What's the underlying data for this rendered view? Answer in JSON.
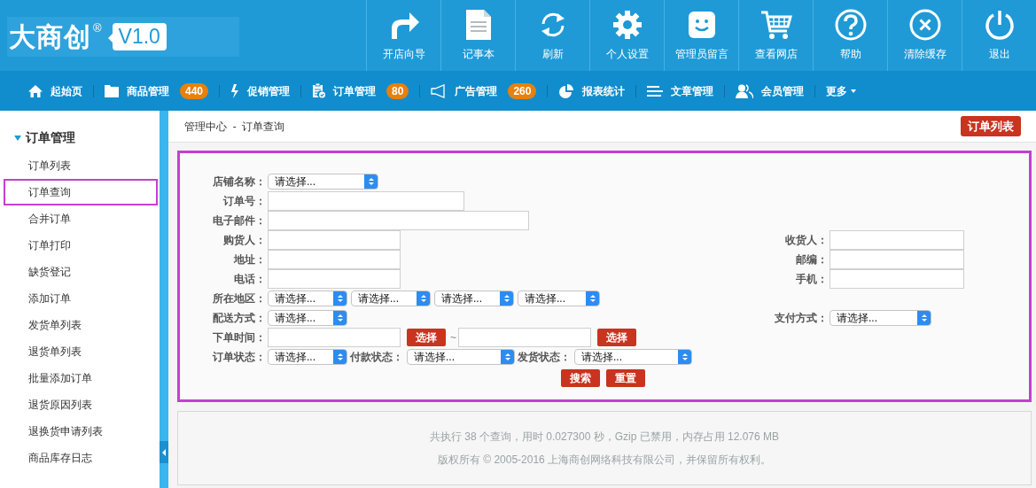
{
  "header": {
    "logo": "大商创",
    "logo_mark": "®",
    "version": "V1.0",
    "toolbar": [
      {
        "label": "开店向导"
      },
      {
        "label": "记事本"
      },
      {
        "label": "刷新"
      },
      {
        "label": "个人设置"
      },
      {
        "label": "管理员留言"
      },
      {
        "label": "查看网店"
      },
      {
        "label": "帮助"
      },
      {
        "label": "清除缓存"
      },
      {
        "label": "退出"
      }
    ]
  },
  "nav": [
    {
      "label": "起始页"
    },
    {
      "label": "商品管理",
      "badge": "440"
    },
    {
      "label": "促销管理"
    },
    {
      "label": "订单管理",
      "badge": "80"
    },
    {
      "label": "广告管理",
      "badge": "260"
    },
    {
      "label": "报表统计"
    },
    {
      "label": "文章管理"
    },
    {
      "label": "会员管理"
    },
    {
      "label": "更多",
      "dropdown": true
    }
  ],
  "sidebar": {
    "title": "订单管理",
    "expanded": true,
    "items": [
      {
        "label": "订单列表",
        "selected": false
      },
      {
        "label": "订单查询",
        "selected": true
      },
      {
        "label": "合并订单",
        "selected": false
      },
      {
        "label": "订单打印",
        "selected": false
      },
      {
        "label": "缺货登记",
        "selected": false
      },
      {
        "label": "添加订单",
        "selected": false
      },
      {
        "label": "发货单列表",
        "selected": false
      },
      {
        "label": "退货单列表",
        "selected": false
      },
      {
        "label": "批量添加订单",
        "selected": false
      },
      {
        "label": "退货原因列表",
        "selected": false
      },
      {
        "label": "退换货申请列表",
        "selected": false
      },
      {
        "label": "商品库存日志",
        "selected": false
      }
    ]
  },
  "breadcrumb": {
    "root": "管理中心",
    "separator": "-",
    "current": "订单查询"
  },
  "action_button": "订单列表",
  "form": {
    "rows": [
      {
        "left": [
          {
            "kind": "select",
            "label": "店铺名称：",
            "value": "请选择..."
          }
        ]
      },
      {
        "left": [
          {
            "kind": "input",
            "label": "订单号："
          }
        ]
      },
      {
        "left": [
          {
            "kind": "input",
            "label": "电子邮件："
          }
        ]
      },
      {
        "left": [
          {
            "kind": "input",
            "label": "购货人："
          }
        ],
        "right": [
          {
            "kind": "input",
            "label": "收货人："
          }
        ]
      },
      {
        "left": [
          {
            "kind": "input",
            "label": "地址："
          }
        ],
        "right": [
          {
            "kind": "input",
            "label": "邮编："
          }
        ]
      },
      {
        "left": [
          {
            "kind": "input",
            "label": "电话："
          }
        ],
        "right": [
          {
            "kind": "input",
            "label": "手机："
          }
        ]
      },
      {
        "left": [
          {
            "kind": "select",
            "label": "所在地区：",
            "value": "请选择..."
          },
          {
            "kind": "select",
            "value": "请选择..."
          },
          {
            "kind": "select",
            "value": "请选择..."
          },
          {
            "kind": "select",
            "value": "请选择..."
          }
        ]
      },
      {
        "left": [
          {
            "kind": "select",
            "label": "配送方式：",
            "value": "请选择..."
          }
        ],
        "right": [
          {
            "kind": "select",
            "label": "支付方式：",
            "value": "请选择..."
          }
        ]
      },
      {
        "left": [
          {
            "kind": "input",
            "label": "下单时间："
          },
          {
            "kind": "button",
            "value": "选择"
          },
          {
            "kind": "text",
            "value": "~"
          },
          {
            "kind": "input"
          },
          {
            "kind": "button",
            "value": "选择"
          }
        ]
      },
      {
        "left": [
          {
            "kind": "select",
            "label": "订单状态：",
            "value": "请选择..."
          },
          {
            "kind": "select",
            "label": "付款状态：",
            "value": "请选择..."
          },
          {
            "kind": "select",
            "label": "发货状态：",
            "value": "请选择..."
          }
        ]
      },
      {
        "left": [
          {
            "kind": "button",
            "value": "搜索"
          },
          {
            "kind": "button",
            "value": "重置"
          }
        ]
      }
    ]
  },
  "footer": [
    "共执行 38 个查询，用时 0.027300 秒，Gzip 已禁用，内存占用 12.076 MB",
    "版权所有 © 2005-2016 上海商创网络科技有限公司，并保留所有权利。"
  ]
}
